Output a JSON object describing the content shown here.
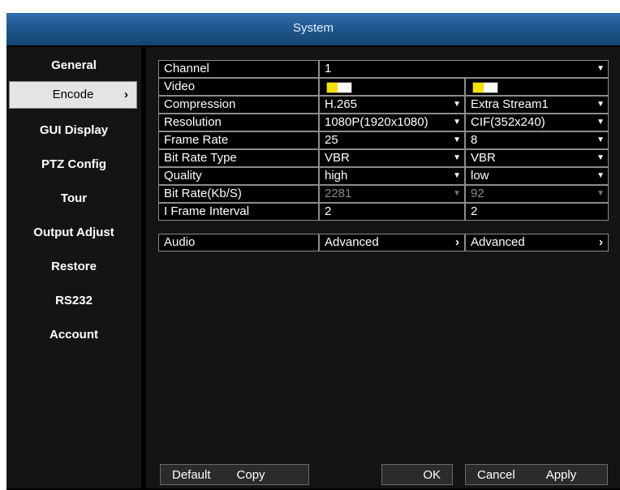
{
  "window": {
    "title": "System"
  },
  "sidebar": {
    "items": [
      {
        "label": "General"
      },
      {
        "label": "Encode",
        "chevron": "›"
      },
      {
        "label": "GUI Display"
      },
      {
        "label": "PTZ Config"
      },
      {
        "label": "Tour"
      },
      {
        "label": "Output Adjust"
      },
      {
        "label": "Restore"
      },
      {
        "label": "RS232"
      },
      {
        "label": "Account"
      }
    ]
  },
  "encode": {
    "rows": [
      {
        "label": "Channel",
        "main": "1",
        "extra": ""
      },
      {
        "label": "Video",
        "main": "",
        "extra": ""
      },
      {
        "label": "Compression",
        "main": "H.265",
        "extra": "Extra Stream1"
      },
      {
        "label": "Resolution",
        "main": "1080P(1920x1080)",
        "extra": "CIF(352x240)"
      },
      {
        "label": "Frame Rate",
        "main": "25",
        "extra": "8"
      },
      {
        "label": "Bit Rate Type",
        "main": "VBR",
        "extra": "VBR"
      },
      {
        "label": "Quality",
        "main": "high",
        "extra": "low"
      },
      {
        "label": "Bit Rate(Kb/S)",
        "main": "2281",
        "extra": "92"
      },
      {
        "label": "I Frame Interval",
        "main": "2",
        "extra": "2"
      }
    ],
    "audio": {
      "label": "Audio",
      "main": "Advanced",
      "extra": "Advanced"
    },
    "video_swatch_colors": {
      "left": "#f5e000",
      "right": "#ffffff"
    }
  },
  "buttons": {
    "default": "Default",
    "copy": "Copy",
    "ok": "OK",
    "cancel": "Cancel",
    "apply": "Apply"
  },
  "colors": {
    "title_bar": "#1f568d",
    "panel": "#141414",
    "active_item": "#e4e4e4"
  }
}
